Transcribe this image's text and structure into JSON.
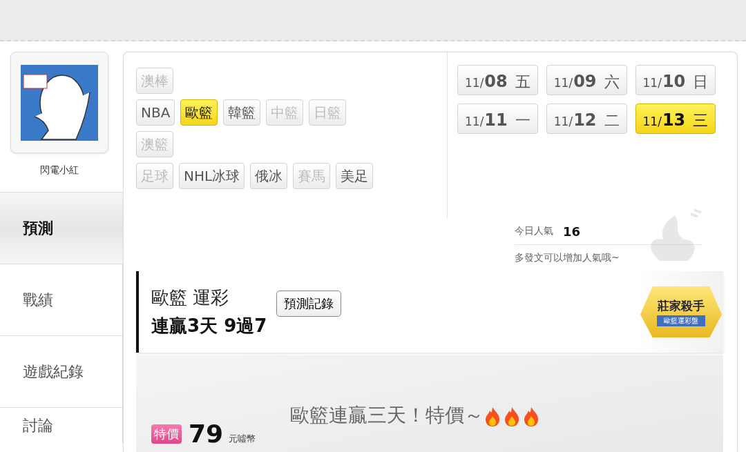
{
  "profile": {
    "name": "閃電小紅"
  },
  "nav": [
    {
      "label": "預測",
      "selected": true
    },
    {
      "label": "戰績",
      "selected": false
    },
    {
      "label": "遊戲紀錄",
      "selected": false
    },
    {
      "label": "討論",
      "selected": false
    }
  ],
  "sport_rows": [
    [
      {
        "label": "澳棒",
        "selected": false,
        "disabled": true
      }
    ],
    [
      {
        "label": "NBA",
        "selected": false,
        "disabled": false
      },
      {
        "label": "歐籃",
        "selected": true,
        "disabled": false
      },
      {
        "label": "韓籃",
        "selected": false,
        "disabled": false
      },
      {
        "label": "中籃",
        "selected": false,
        "disabled": true
      },
      {
        "label": "日籃",
        "selected": false,
        "disabled": true
      }
    ],
    [
      {
        "label": "澳籃",
        "selected": false,
        "disabled": true
      }
    ],
    [
      {
        "label": "足球",
        "selected": false,
        "disabled": true
      },
      {
        "label": "NHL冰球",
        "selected": false,
        "disabled": false
      },
      {
        "label": "俄冰",
        "selected": false,
        "disabled": false
      },
      {
        "label": "賽馬",
        "selected": false,
        "disabled": true
      },
      {
        "label": "美足",
        "selected": false,
        "disabled": false
      }
    ]
  ],
  "date_rows": [
    [
      {
        "month": "11/",
        "day": "08",
        "weekday": "五",
        "selected": false
      },
      {
        "month": "11/",
        "day": "09",
        "weekday": "六",
        "selected": false
      },
      {
        "month": "11/",
        "day": "10",
        "weekday": "日",
        "selected": false
      }
    ],
    [
      {
        "month": "11/",
        "day": "11",
        "weekday": "一",
        "selected": false
      },
      {
        "month": "11/",
        "day": "12",
        "weekday": "二",
        "selected": false
      },
      {
        "month": "11/",
        "day": "13",
        "weekday": "三",
        "selected": true
      }
    ]
  ],
  "popularity": {
    "label": "今日人氣",
    "value": "16",
    "hint": "多發文可以增加人氣哦~"
  },
  "prediction": {
    "title": "歐籃 運彩",
    "record": "連贏3天 9過7",
    "button": "預測記錄",
    "badge_title": "莊家殺手",
    "badge_subtitle": "歐籃運彩盤"
  },
  "promo": {
    "tag": "特價",
    "price": "79",
    "unit": "元噓幣",
    "headline": "歐籃連贏三天！特價～"
  }
}
